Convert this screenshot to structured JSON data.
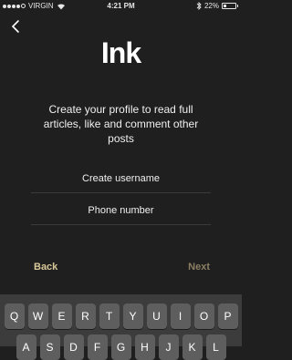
{
  "status_bar": {
    "carrier": "VIRGIN",
    "time": "4:21 PM",
    "battery": "22%",
    "battery_level": 0.22,
    "signal_bars_filled": 4,
    "signal_bars_total": 5
  },
  "header": {
    "back_icon": "chevron-left-icon",
    "logo": "Ink"
  },
  "intro_text": "Create your profile to read full articles, like and comment other posts",
  "form": {
    "username_placeholder": "Create username",
    "phone_placeholder": "Phone number"
  },
  "nav": {
    "back_label": "Back",
    "next_label": "Next"
  },
  "keyboard": {
    "row1": [
      "Q",
      "W",
      "E",
      "R",
      "T",
      "Y",
      "U",
      "I",
      "O",
      "P"
    ],
    "row2": [
      "A",
      "S",
      "D",
      "F",
      "G",
      "H",
      "J",
      "K",
      "L"
    ]
  },
  "colors": {
    "background": "#1f1f1f",
    "accent": "#d8c89a",
    "accent_disabled": "#8a7f63"
  }
}
